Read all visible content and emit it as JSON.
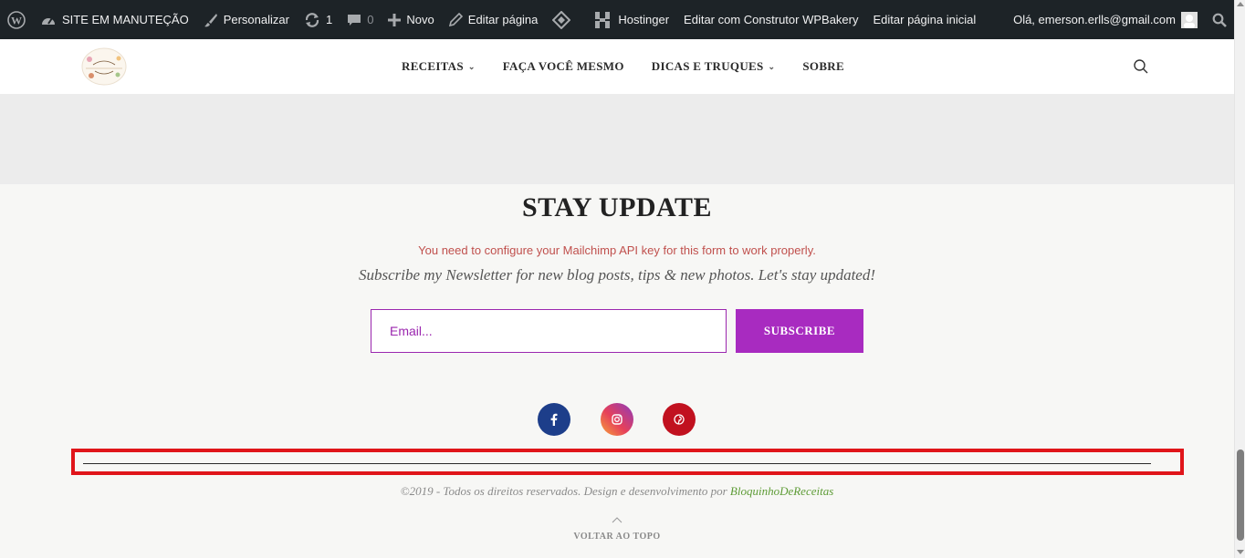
{
  "admin_bar": {
    "site_label": "SITE EM MANUTEÇÃO",
    "customize_label": "Personalizar",
    "updates_count": "1",
    "comments_count": "0",
    "new_label": "Novo",
    "edit_page_label": "Editar página",
    "hostinger_label": "Hostinger",
    "wpbakery_label": "Editar com Construtor WPBakery",
    "edit_home_label": "Editar página inicial",
    "greeting": "Olá, emerson.erlls@gmail.com"
  },
  "nav": {
    "items": [
      {
        "label": "RECEITAS",
        "has_dropdown": true
      },
      {
        "label": "FAÇA VOCÊ MESMO",
        "has_dropdown": false
      },
      {
        "label": "DICAS E TRUQUES",
        "has_dropdown": true
      },
      {
        "label": "SOBRE",
        "has_dropdown": false
      }
    ]
  },
  "newsletter": {
    "title": "STAY UPDATE",
    "warning": "You need to configure your Mailchimp API key for this form to work properly.",
    "description": "Subscribe my Newsletter for new blog posts, tips & new photos. Let's stay updated!",
    "email_placeholder": "Email...",
    "email_value": "",
    "subscribe_label": "SUBSCRIBE"
  },
  "social": {
    "facebook_icon": "facebook-icon",
    "instagram_icon": "instagram-icon",
    "pinterest_icon": "pinterest-icon"
  },
  "footer": {
    "copyright_text": "©2019 - Todos os direitos reservados. Design e desenvolvimento por ",
    "copyright_link": "BloquinhoDeReceitas",
    "back_to_top": "VOLTAR AO TOPO"
  },
  "colors": {
    "admin_bar_bg": "#1d2327",
    "accent_purple": "#a82bc0",
    "warning_red": "#c0504d",
    "highlight_red": "#e0151a",
    "facebook_blue": "#1d3e8a",
    "pinterest_red": "#c1111f",
    "link_green": "#5d9b35"
  }
}
